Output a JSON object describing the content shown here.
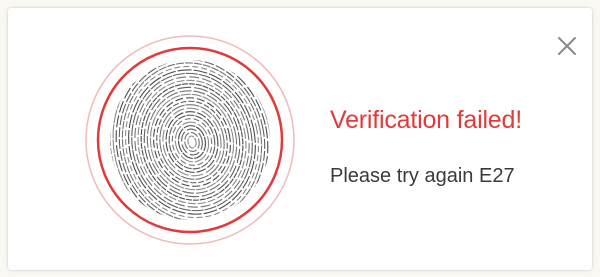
{
  "dialog": {
    "title": "Verification failed!",
    "message": "Please try again E27",
    "close_icon": "close-icon",
    "fingerprint_icon": "fingerprint-icon"
  },
  "colors": {
    "accent_error": "#e23a3a",
    "ring_outer": "#f2b9b9",
    "text": "#3a3a3a",
    "close_icon": "#8a8a8a"
  }
}
